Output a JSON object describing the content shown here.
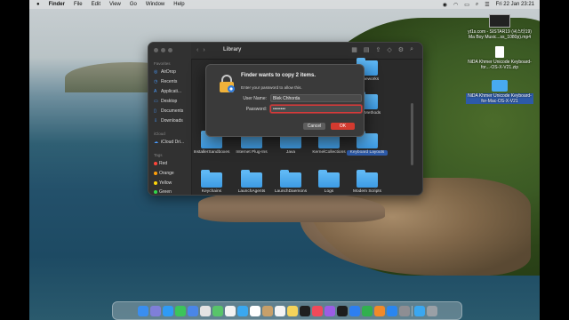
{
  "menubar": {
    "apple": "",
    "app": "Finder",
    "items": [
      "File",
      "Edit",
      "View",
      "Go",
      "Window",
      "Help"
    ],
    "datetime": "Fri 22 Jan  23:21"
  },
  "desktop": {
    "files": [
      {
        "label": "yt1s.com - SISTAR19 (씨스타19) Ma Boy Music...ss_1080p).mp4",
        "kind": "image"
      },
      {
        "label": "NiDA Khmer Unicode Keyboard-for...-OS-X-V21.zip",
        "kind": "doc"
      },
      {
        "label": "NiDA Khmer Unicode Keyboard-for-Mac-OS-X-V21",
        "kind": "folder"
      }
    ]
  },
  "finder": {
    "title": "Library",
    "sidebar": {
      "favorites_header": "Favorites",
      "favorites": [
        {
          "label": "AirDrop",
          "icon": "airdrop-icon"
        },
        {
          "label": "Recents",
          "icon": "clock-icon"
        },
        {
          "label": "Applicati...",
          "icon": "applications-icon"
        },
        {
          "label": "Desktop",
          "icon": "desktop-icon"
        },
        {
          "label": "Documents",
          "icon": "document-icon"
        },
        {
          "label": "Downloads",
          "icon": "download-icon"
        }
      ],
      "icloud_header": "iCloud",
      "icloud": [
        {
          "label": "iCloud Dri...",
          "icon": "cloud-icon"
        }
      ],
      "tags_header": "Tags",
      "tags": [
        {
          "label": "Red",
          "color": "#ff453a"
        },
        {
          "label": "Orange",
          "color": "#ff9f0a"
        },
        {
          "label": "Yellow",
          "color": "#ffd60a"
        },
        {
          "label": "Green",
          "color": "#32d74b"
        }
      ]
    },
    "items": [
      {
        "label": "Frameworks"
      },
      {
        "label": "Input Methods"
      },
      {
        "label": "InstallerSandboxes"
      },
      {
        "label": "Internet Plug-Ins"
      },
      {
        "label": "Java"
      },
      {
        "label": "KernelCollections"
      },
      {
        "label": "Keyboard Layouts"
      },
      {
        "label": "Keychains"
      },
      {
        "label": "LaunchAgents"
      },
      {
        "label": "LaunchDaemons"
      },
      {
        "label": "Logs"
      },
      {
        "label": "Modem Scripts"
      }
    ]
  },
  "dialog": {
    "title": "Finder wants to copy 2 items.",
    "subtitle": "Enter your password to allow this.",
    "username_label": "User Name:",
    "username_value": "Blek Chhorda",
    "password_label": "Password:",
    "password_value": "••••••••",
    "cancel_label": "Cancel",
    "ok_label": "OK"
  },
  "colors": {
    "accent_red": "#d33a2f",
    "folder_blue": "#4aa8f0",
    "selection_blue": "#2d5aa8"
  }
}
